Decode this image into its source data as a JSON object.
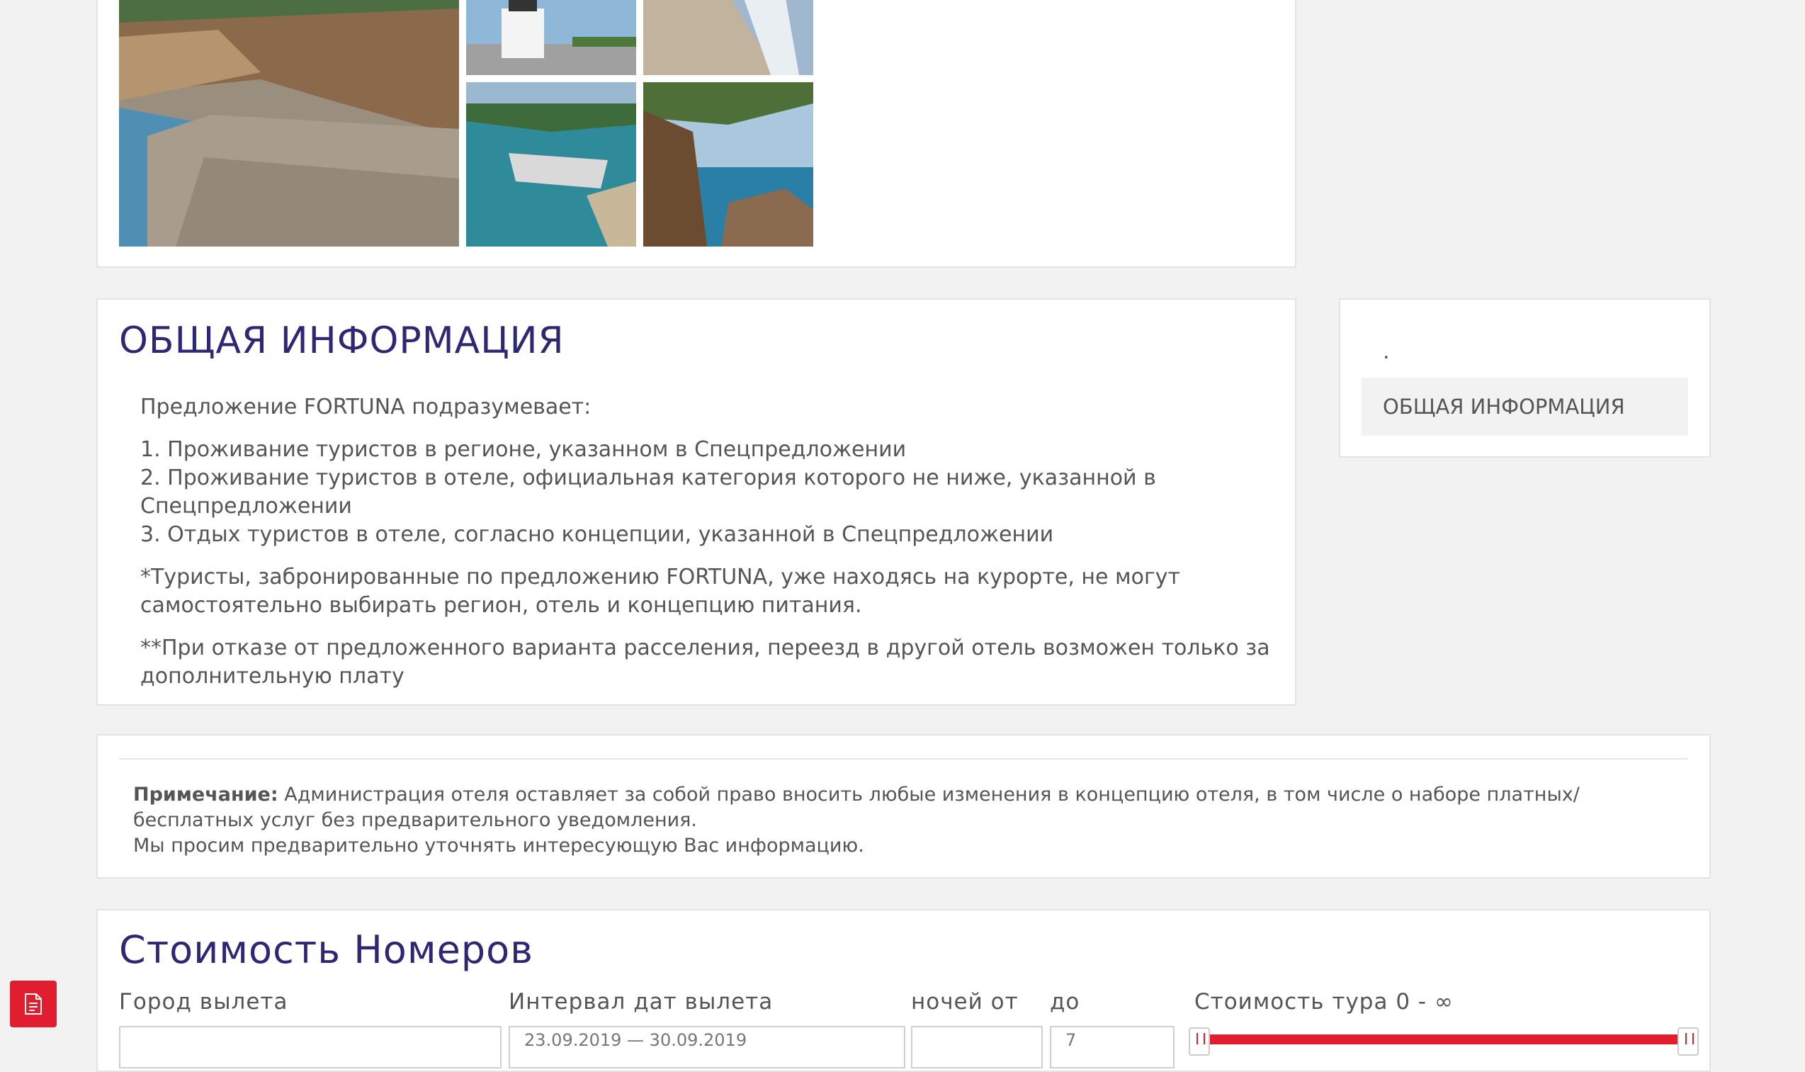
{
  "colors": {
    "accent": "#e01e2f",
    "title": "#2e2874",
    "background": "#f2f2f2"
  },
  "gallery": {
    "photos": [
      "beach-pebbles-photo",
      "marina-building-photo",
      "shore-waves-photo",
      "harbor-aerial-photo",
      "pine-cliff-sea-photo"
    ]
  },
  "info": {
    "title": "ОБЩАЯ ИНФОРМАЦИЯ",
    "intro": "Предложение FORTUNA подразумевает:",
    "items": [
      "1. Проживание туристов в регионе, указанном в Спецпредложении",
      "2. Проживание туристов в отеле, официальная категория которого не ниже, указанной в Спецпредложении",
      "3. Отдых туристов в отеле, согласно концепции, указанной в Спецпредложении"
    ],
    "note1": "*Туристы, забронированные по предложению FORTUNA, уже находясь на курорте, не могут самостоятельно выбирать регион, отель и концепцию питания.",
    "note2": "**При отказе от предложенного варианта расселения, переезд в другой отель возможен только за дополнительную плату"
  },
  "side_nav": {
    "dot": ".",
    "item": "ОБЩАЯ ИНФОРМАЦИЯ"
  },
  "note": {
    "label": "Примечание:",
    "text": "Администрация отеля оставляет за собой право вносить любые изменения в концепцию отеля, в том числе о наборе платных/бесплатных услуг без предварительного уведомления.",
    "text2": "Мы просим предварительно уточнять интересующую Вас информацию."
  },
  "prices": {
    "title": "Стоимость Номеров",
    "city_label": "Город вылета",
    "dates_label": "Интервал дат вылета",
    "dates_value": "23.09.2019 — 30.09.2019",
    "nights_from_label": "ночей от",
    "nights_to_label": "до",
    "nights_to_value": "7",
    "cost_label": "Стоимость тура 0 - ∞"
  },
  "pdf_icon": "document-icon"
}
